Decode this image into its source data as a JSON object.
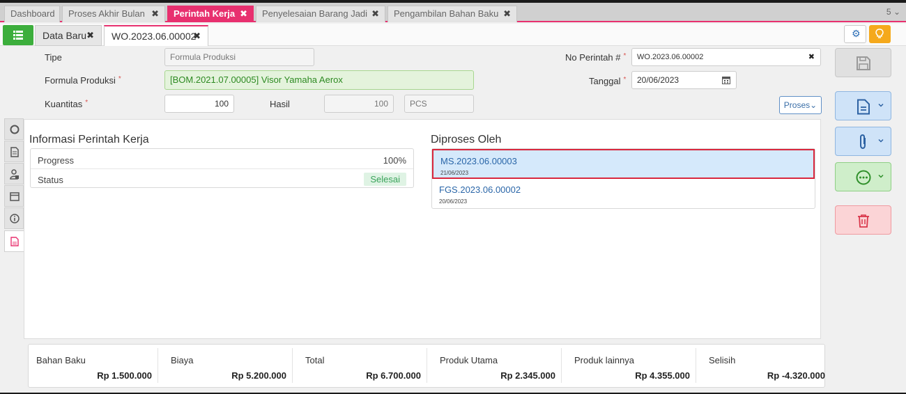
{
  "top_tabs": [
    {
      "label": "Dashboard",
      "closable": false,
      "active": false
    },
    {
      "label": "Proses Akhir Bulan",
      "closable": true,
      "active": false
    },
    {
      "label": "Perintah Kerja",
      "closable": true,
      "active": true
    },
    {
      "label": "Penyelesaian Barang Jadi",
      "closable": true,
      "active": false
    },
    {
      "label": "Pengambilan Bahan Baku",
      "closable": true,
      "active": false
    }
  ],
  "tab_count": "5",
  "sub_tabs": [
    {
      "label": "Data Baru",
      "active": false
    },
    {
      "label": "WO.2023.06.00002",
      "active": true
    }
  ],
  "form": {
    "tipe_label": "Tipe",
    "tipe_value": "Formula Produksi",
    "formula_label": "Formula Produksi",
    "formula_value": "[BOM.2021.07.00005] Visor Yamaha Aerox",
    "kuantitas_label": "Kuantitas",
    "kuantitas_value": "100",
    "hasil_label": "Hasil",
    "hasil_value": "100",
    "unit_value": "PCS",
    "no_perintah_label": "No Perintah #",
    "no_perintah_value": "WO.2023.06.00002",
    "tanggal_label": "Tanggal",
    "tanggal_value": "20/06/2023",
    "required_mark": "*",
    "proses_button": "Proses"
  },
  "info": {
    "title": "Informasi Perintah Kerja",
    "progress_label": "Progress",
    "progress_value": "100%",
    "status_label": "Status",
    "status_value": "Selesai"
  },
  "diproses": {
    "title": "Diproses Oleh",
    "items": [
      {
        "code": "MS.2023.06.00003",
        "date": "21/06/2023",
        "selected": true
      },
      {
        "code": "FGS.2023.06.00002",
        "date": "20/06/2023",
        "selected": false
      }
    ]
  },
  "summary": [
    {
      "label": "Bahan Baku",
      "value": "Rp 1.500.000"
    },
    {
      "label": "Biaya",
      "value": "Rp 5.200.000"
    },
    {
      "label": "Total",
      "value": "Rp 6.700.000"
    },
    {
      "label": "Produk Utama",
      "value": "Rp 2.345.000"
    },
    {
      "label": "Produk lainnya",
      "value": "Rp 4.355.000"
    },
    {
      "label": "Selisih",
      "value": "Rp -4.320.000"
    }
  ],
  "icons": {
    "menu": "list-icon",
    "settings": "gear-icon",
    "tips": "lightbulb-icon",
    "save": "save-icon",
    "document": "document-icon",
    "attachment": "paperclip-icon",
    "more": "more-icon",
    "delete": "trash-icon"
  },
  "colors": {
    "accent": "#e8306f",
    "green": "#3cae3c",
    "warning": "#f5a91c",
    "link": "#2a66a8"
  }
}
